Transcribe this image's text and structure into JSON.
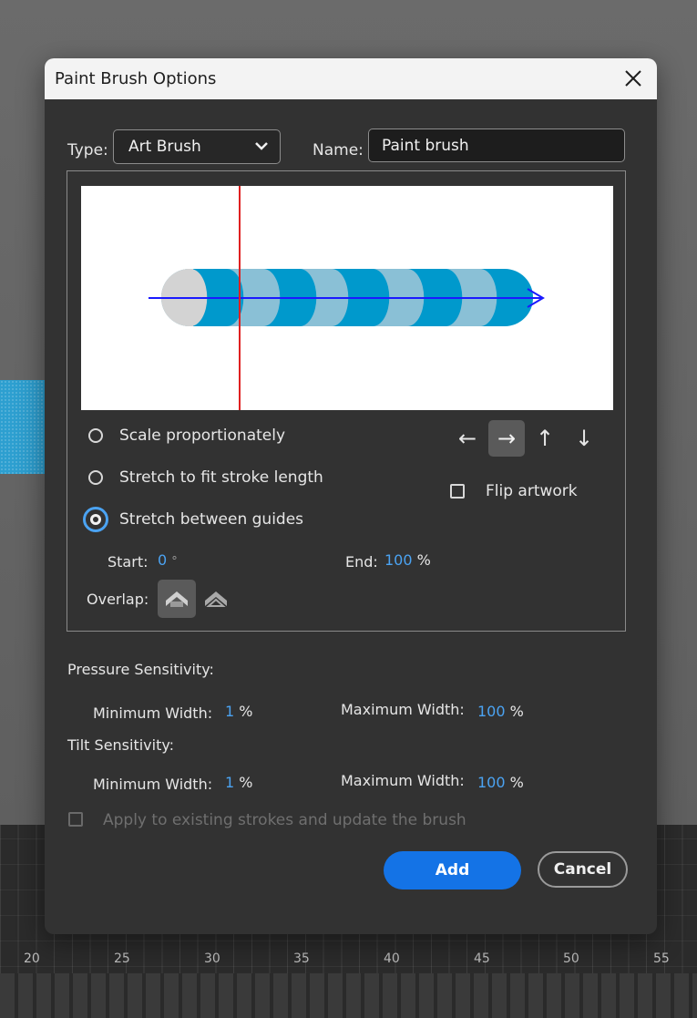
{
  "background": {
    "ruler_labels": [
      "20",
      "25",
      "30",
      "35",
      "40",
      "45",
      "50",
      "55"
    ],
    "faint_markers": [
      "25",
      "25"
    ]
  },
  "dialog": {
    "title": "Paint Brush Options",
    "close_icon": "close-icon",
    "type_label": "Type:",
    "type_value": "Art Brush",
    "name_label": "Name:",
    "name_value": "Paint brush",
    "preview": {
      "stripe_colors": [
        "#0099cc",
        "#8ac0d6"
      ],
      "cap_color": "#d3d3d3",
      "guide_color": "#e02020",
      "direction_arrow_color": "#1a1aff"
    },
    "scale_options": [
      {
        "label": "Scale proportionately",
        "selected": false
      },
      {
        "label": "Stretch to fit stroke length",
        "selected": false
      },
      {
        "label": "Stretch between guides",
        "selected": true
      }
    ],
    "direction_buttons": [
      {
        "glyph": "←",
        "name": "arrow-left-icon",
        "active": false
      },
      {
        "glyph": "→",
        "name": "arrow-right-icon",
        "active": true
      },
      {
        "glyph": "↑",
        "name": "arrow-up-icon",
        "active": false
      },
      {
        "glyph": "↓",
        "name": "arrow-down-icon",
        "active": false
      }
    ],
    "flip_artwork_label": "Flip artwork",
    "start_label": "Start:",
    "start_value": "0",
    "start_unit": "°",
    "end_label": "End:",
    "end_value": "100",
    "end_unit": "%",
    "overlap_label": "Overlap:",
    "pressure_label": "Pressure Sensitivity:",
    "tilt_label": "Tilt Sensitivity:",
    "min_width_label": "Minimum Width:",
    "max_width_label": "Maximum Width:",
    "pressure_min": "1",
    "pressure_max": "100",
    "tilt_min": "1",
    "tilt_max": "100",
    "pct": "%",
    "apply_label": "Apply to existing strokes and update the brush",
    "add_label": "Add",
    "cancel_label": "Cancel",
    "accent_color": "#1473e6"
  }
}
